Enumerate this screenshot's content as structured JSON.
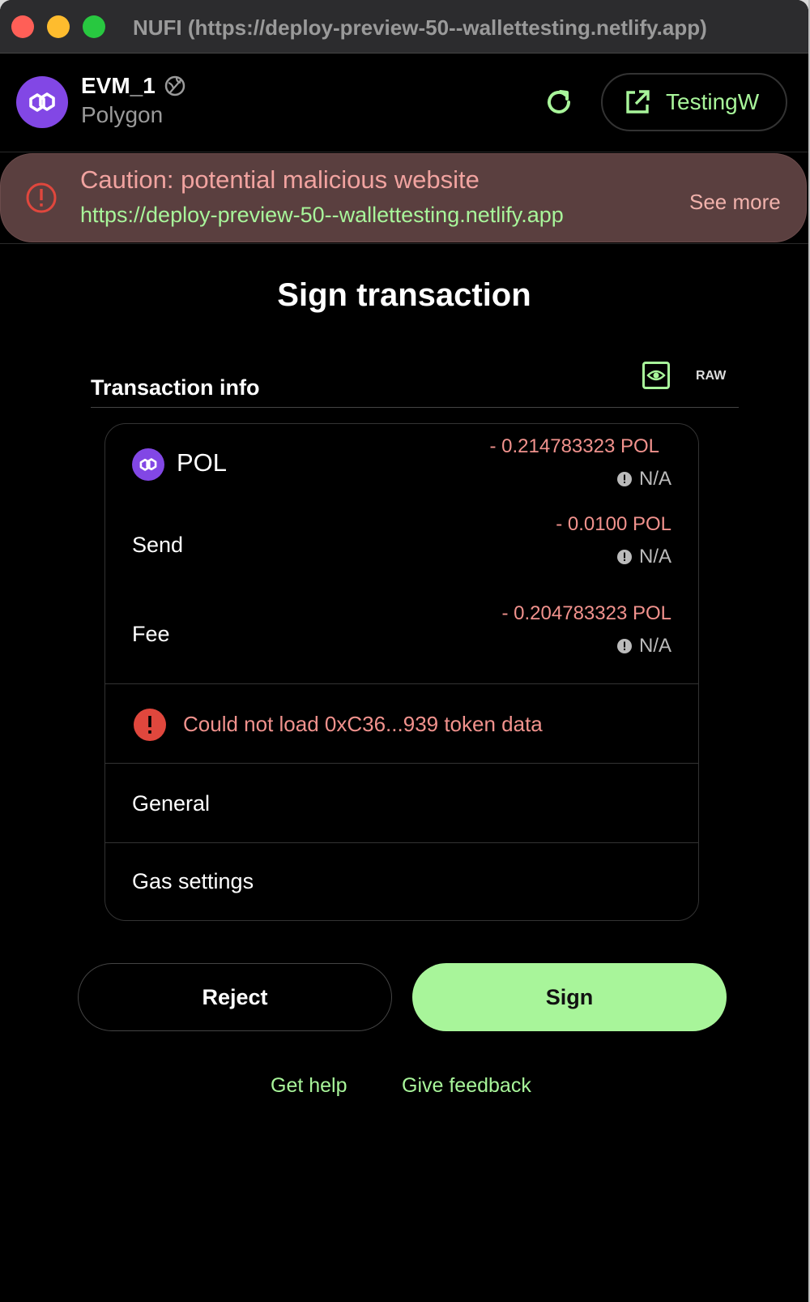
{
  "window": {
    "title": "NUFI (https://deploy-preview-50--wallettesting.netlify.app)"
  },
  "account": {
    "name": "EVM_1",
    "network": "Polygon",
    "dapp_button": "TestingW"
  },
  "banner": {
    "title": "Caution: potential malicious website",
    "url": "https://deploy-preview-50--wallettesting.netlify.app",
    "see_more": "See more"
  },
  "page": {
    "heading": "Sign transaction",
    "tx_info_label": "Transaction info",
    "raw_label": "RAW"
  },
  "tx": {
    "token": {
      "symbol": "POL",
      "amount": "- 0.214783323 POL",
      "fiat": "N/A"
    },
    "send": {
      "label": "Send",
      "amount": "- 0.0100 POL",
      "fiat": "N/A"
    },
    "fee": {
      "label": "Fee",
      "amount": "- 0.204783323 POL",
      "fiat": "N/A"
    },
    "error": "Could not load 0xC36...939 token data",
    "general_label": "General",
    "gas_label": "Gas settings"
  },
  "actions": {
    "reject": "Reject",
    "sign": "Sign"
  },
  "links": {
    "help": "Get help",
    "feedback": "Give feedback"
  },
  "colors": {
    "accent": "#a8f59a",
    "polygon": "#8247e5",
    "danger": "#e0473d",
    "warning_bg": "#5a3f3f"
  }
}
